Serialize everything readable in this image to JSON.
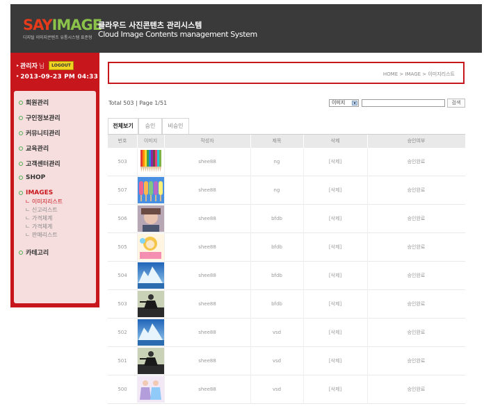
{
  "header": {
    "logo_say": "SAY",
    "logo_image": "IMAGE",
    "logo_tagline": "디지털 이미지콘텐츠 유통시스템 표준형",
    "system_title_ko": "클라우드 사진콘텐츠 관리시스템",
    "system_title_en": "Cloud Image Contents management System"
  },
  "user": {
    "role": "관리자",
    "honorific": "님",
    "logout_label": "LOGOUT",
    "datetime": "2013-09-23 PM 04:33"
  },
  "menu": [
    {
      "label": "회원관리"
    },
    {
      "label": "구인정보관리"
    },
    {
      "label": "커뮤니티관리"
    },
    {
      "label": "교육관리"
    },
    {
      "label": "고객센터관리"
    },
    {
      "label": "SHOP"
    },
    {
      "label": "IMAGES"
    },
    {
      "label": "카테고리"
    }
  ],
  "submenu": [
    {
      "label": "ㄴ 이미지리스트"
    },
    {
      "label": "ㄴ 신고리스트"
    },
    {
      "label": "ㄴ 가격체계"
    },
    {
      "label": "ㄴ 가격체계"
    },
    {
      "label": "ㄴ 판매리스트"
    }
  ],
  "breadcrumb": "HOME > IMAGE > 이미지리스트",
  "list": {
    "summary": "Total 503 | Page 1/51",
    "search_select": "이미지",
    "search_button": "검색"
  },
  "tabs": [
    {
      "label": "전체보기"
    },
    {
      "label": "승인"
    },
    {
      "label": "비승인"
    }
  ],
  "table": {
    "columns": [
      "번호",
      "이미지",
      "작성자",
      "제목",
      "삭제",
      "승인여부"
    ],
    "rows": [
      {
        "no": "503",
        "author": "shee88",
        "title": "ng",
        "delete": "[삭제]",
        "status": "승인완료",
        "thumb": "pencils"
      },
      {
        "no": "507",
        "author": "shee88",
        "title": "ng",
        "delete": "[삭제]",
        "status": "승인완료",
        "thumb": "popsicles"
      },
      {
        "no": "506",
        "author": "shee88",
        "title": "bfdb",
        "delete": "[삭제]",
        "status": "승인완료",
        "thumb": "portrait"
      },
      {
        "no": "505",
        "author": "shee88",
        "title": "bfdb",
        "delete": "[삭제]",
        "status": "승인완료",
        "thumb": "cartoon"
      },
      {
        "no": "504",
        "author": "shee88",
        "title": "bfdb",
        "delete": "[삭제]",
        "status": "승인완료",
        "thumb": "glacier"
      },
      {
        "no": "503",
        "author": "shee88",
        "title": "bfdb",
        "delete": "[삭제]",
        "status": "승인완료",
        "thumb": "dancer"
      },
      {
        "no": "502",
        "author": "shee88",
        "title": "vsd",
        "delete": "[삭제]",
        "status": "승인완료",
        "thumb": "glacier"
      },
      {
        "no": "501",
        "author": "shee88",
        "title": "vsd",
        "delete": "[삭제]",
        "status": "승인완료",
        "thumb": "dancer"
      },
      {
        "no": "500",
        "author": "shee88",
        "title": "vsd",
        "delete": "[삭제]",
        "status": "승인완료",
        "thumb": "dancers"
      }
    ]
  },
  "colors": {
    "brand_red": "#c8161d",
    "header_bg": "#3a3a3a",
    "logo_green": "#8bc34a"
  }
}
